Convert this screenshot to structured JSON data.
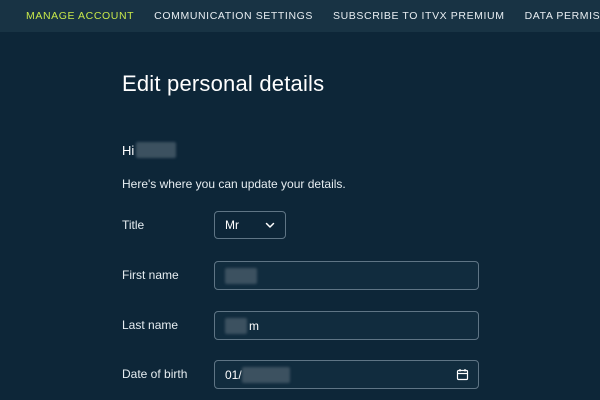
{
  "nav": {
    "tabs": [
      {
        "label": "MANAGE ACCOUNT",
        "active": true
      },
      {
        "label": "COMMUNICATION SETTINGS",
        "active": false
      },
      {
        "label": "SUBSCRIBE TO ITVX PREMIUM",
        "active": false
      },
      {
        "label": "DATA PERMISSIONS",
        "active": false
      }
    ]
  },
  "page": {
    "title": "Edit personal details",
    "greeting_prefix": "Hi",
    "intro": "Here's where you can update your details."
  },
  "form": {
    "title_label": "Title",
    "title_value": "Mr",
    "first_name_label": "First name",
    "last_name_label": "Last name",
    "last_name_visible_suffix": "m",
    "dob_label": "Date of birth",
    "dob_visible_prefix": "01/"
  },
  "colors": {
    "background": "#0d2638",
    "nav_background": "#183344",
    "active_tab": "#c8e84a",
    "field_border": "#5f7585"
  },
  "icons": {
    "title_select": "chevron-down-icon",
    "dob_field": "calendar-icon"
  }
}
